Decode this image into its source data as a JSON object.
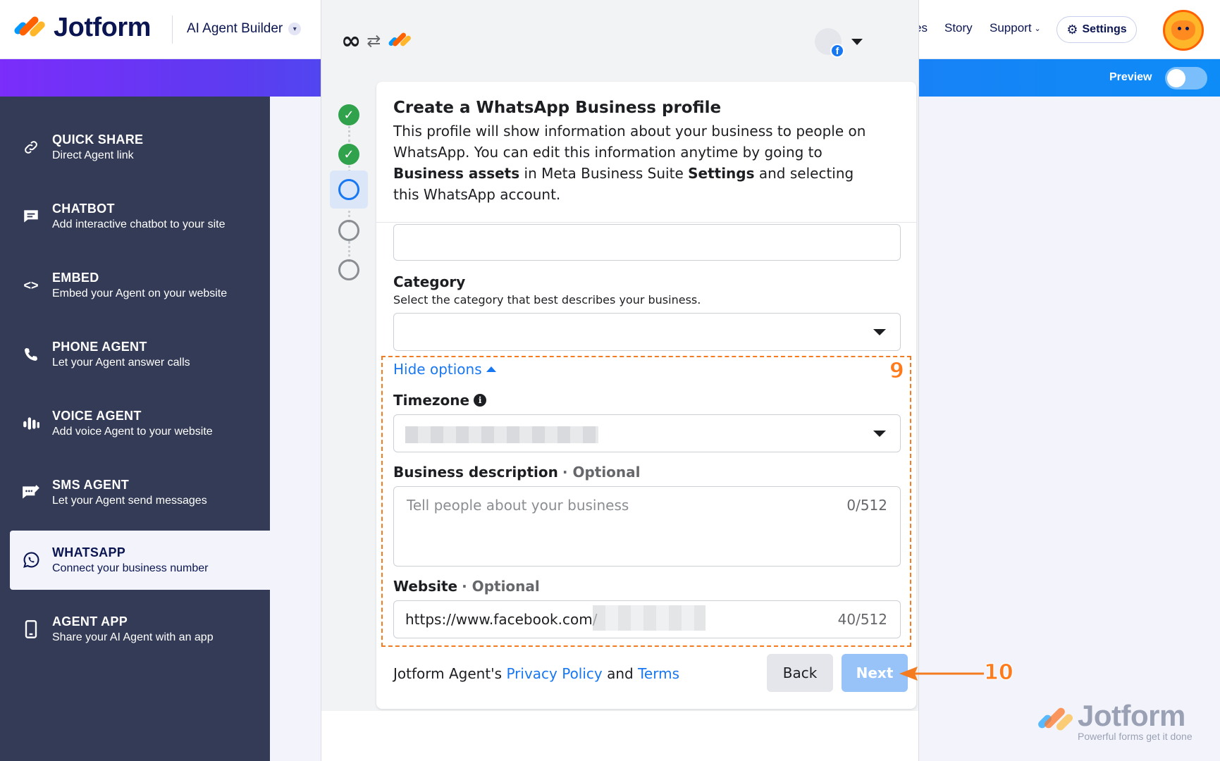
{
  "topnav": {
    "brand": "Jotform",
    "product": "AI Agent Builder",
    "links_stub": "es",
    "story": "Story",
    "support": "Support",
    "settings": "Settings"
  },
  "gradbar": {
    "preview_label": "Preview",
    "preview_on": false
  },
  "sidebar": {
    "items": [
      {
        "title": "QUICK SHARE",
        "subtitle": "Direct Agent link",
        "icon": "link-icon"
      },
      {
        "title": "CHATBOT",
        "subtitle": "Add interactive chatbot to your site",
        "icon": "chat-icon"
      },
      {
        "title": "EMBED",
        "subtitle": "Embed your Agent on your website",
        "icon": "code-icon"
      },
      {
        "title": "PHONE AGENT",
        "subtitle": "Let your Agent answer calls",
        "icon": "phone-icon"
      },
      {
        "title": "VOICE AGENT",
        "subtitle": "Add voice Agent to your website",
        "icon": "voice-bars-icon"
      },
      {
        "title": "SMS AGENT",
        "subtitle": "Let your Agent send messages",
        "icon": "sms-icon"
      },
      {
        "title": "WHATSAPP",
        "subtitle": "Connect your business number",
        "icon": "whatsapp-icon"
      },
      {
        "title": "AGENT APP",
        "subtitle": "Share your AI Agent with an app",
        "icon": "mobile-app-icon"
      }
    ],
    "active_index": 6
  },
  "modal": {
    "title": "Create a WhatsApp Business profile",
    "desc_1": "This profile will show information about your business to people on WhatsApp. You can edit this information anytime by going to ",
    "desc_b1": "Business assets",
    "desc_2": " in Meta Business Suite ",
    "desc_b2": "Settings",
    "desc_3": " and selecting this WhatsApp account.",
    "category_label": "Category",
    "category_help": "Select the category that best describes your business.",
    "hide_options": "Hide options",
    "timezone_label": "Timezone",
    "desc_label": "Business description",
    "desc_optional": "· Optional",
    "desc_placeholder": "Tell people about your business",
    "desc_counter": "0/512",
    "website_label": "Website",
    "website_optional": "· Optional",
    "website_value": "https://www.facebook.com/",
    "website_counter": "40/512",
    "footer_prefix": "Jotform Agent's ",
    "footer_privacy": "Privacy Policy",
    "footer_and": " and ",
    "footer_terms": "Terms",
    "back": "Back",
    "next": "Next",
    "steps": [
      "done",
      "done",
      "current",
      "todo",
      "todo"
    ]
  },
  "annotations": {
    "box_label": "9",
    "arrow_label": "10",
    "color": "#f47b20"
  },
  "watermark": {
    "title": "Jotform",
    "subtitle": "Powerful forms get it done"
  }
}
